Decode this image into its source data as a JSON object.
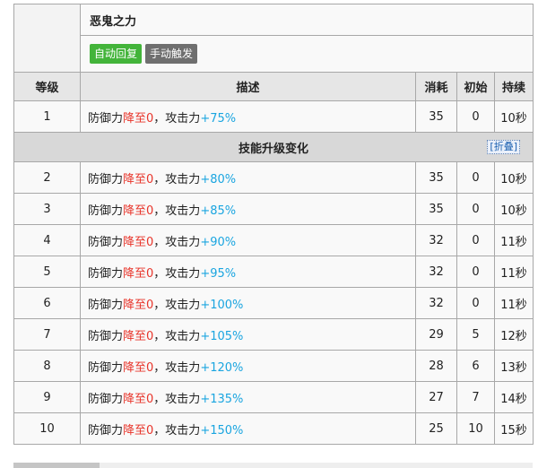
{
  "skill": {
    "name": "恶鬼之力",
    "tags": [
      "自动回复",
      "手动触发"
    ]
  },
  "columns": [
    "等级",
    "描述",
    "消耗",
    "初始",
    "持续"
  ],
  "base_row": {
    "level": "1",
    "desc_a": "防御力",
    "desc_b": "降至0",
    "desc_c": "，攻击力",
    "desc_d": "+75%",
    "cost": "35",
    "initial": "0",
    "duration": "10秒"
  },
  "section": {
    "title": "技能升级变化",
    "fold_label": "[折叠]"
  },
  "rows": [
    {
      "level": "2",
      "desc_a": "防御力",
      "desc_b": "降至0",
      "desc_c": "，攻击力",
      "desc_d": "+80%",
      "cost": "35",
      "initial": "0",
      "duration": "10秒"
    },
    {
      "level": "3",
      "desc_a": "防御力",
      "desc_b": "降至0",
      "desc_c": "，攻击力",
      "desc_d": "+85%",
      "cost": "35",
      "initial": "0",
      "duration": "10秒"
    },
    {
      "level": "4",
      "desc_a": "防御力",
      "desc_b": "降至0",
      "desc_c": "，攻击力",
      "desc_d": "+90%",
      "cost": "32",
      "initial": "0",
      "duration": "11秒"
    },
    {
      "level": "5",
      "desc_a": "防御力",
      "desc_b": "降至0",
      "desc_c": "，攻击力",
      "desc_d": "+95%",
      "cost": "32",
      "initial": "0",
      "duration": "11秒"
    },
    {
      "level": "6",
      "desc_a": "防御力",
      "desc_b": "降至0",
      "desc_c": "，攻击力",
      "desc_d": "+100%",
      "cost": "32",
      "initial": "0",
      "duration": "11秒"
    },
    {
      "level": "7",
      "desc_a": "防御力",
      "desc_b": "降至0",
      "desc_c": "，攻击力",
      "desc_d": "+105%",
      "cost": "29",
      "initial": "5",
      "duration": "12秒"
    },
    {
      "level": "8",
      "desc_a": "防御力",
      "desc_b": "降至0",
      "desc_c": "，攻击力",
      "desc_d": "+120%",
      "cost": "28",
      "initial": "6",
      "duration": "13秒"
    },
    {
      "level": "9",
      "desc_a": "防御力",
      "desc_b": "降至0",
      "desc_c": "，攻击力",
      "desc_d": "+135%",
      "cost": "27",
      "initial": "7",
      "duration": "14秒"
    },
    {
      "level": "10",
      "desc_a": "防御力",
      "desc_b": "降至0",
      "desc_c": "，攻击力",
      "desc_d": "+150%",
      "cost": "25",
      "initial": "10",
      "duration": "15秒"
    }
  ],
  "colors": {
    "tag_auto": "#43b43a",
    "tag_manual": "#6f6f6f",
    "decrease": "#e8352b",
    "increase": "#1aa5e0"
  }
}
